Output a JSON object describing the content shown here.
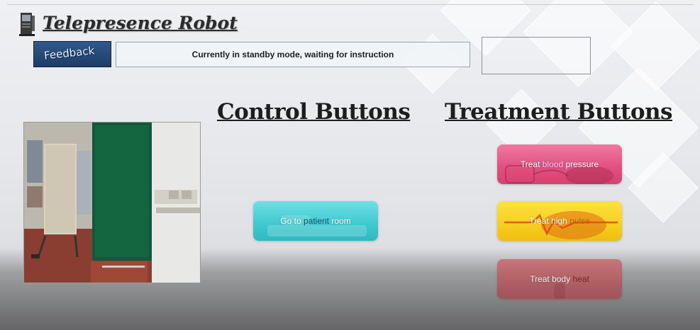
{
  "app": {
    "title": "Telepresence Robot",
    "icon": "robot-computer-icon"
  },
  "toolbar": {
    "feedback_label": "Feedback",
    "status_text": "Currently in standby mode, waiting for instruction"
  },
  "sections": {
    "control_heading": "Control Buttons",
    "treatment_heading": "Treatment Buttons"
  },
  "camera_feed": {
    "icon": "camera-video-icon"
  },
  "control_buttons": {
    "go_to_room": {
      "pre": "Go to ",
      "highlight": "patient",
      "post": " room"
    }
  },
  "treatment_buttons": {
    "blood": {
      "pre": "Treat ",
      "highlight": "blood",
      "post": " pressure"
    },
    "pulse": {
      "pre": "Treat high ",
      "highlight": "pulse",
      "post": ""
    },
    "heat": {
      "pre": "Treat body ",
      "highlight": "heat",
      "post": ""
    }
  },
  "colors": {
    "patient_button": "#3dc9cf",
    "blood_button": "#e14e80",
    "pulse_button": "#f6cf1f",
    "heat_button": "#b5565b",
    "feedback_button": "#2f5a8b"
  }
}
